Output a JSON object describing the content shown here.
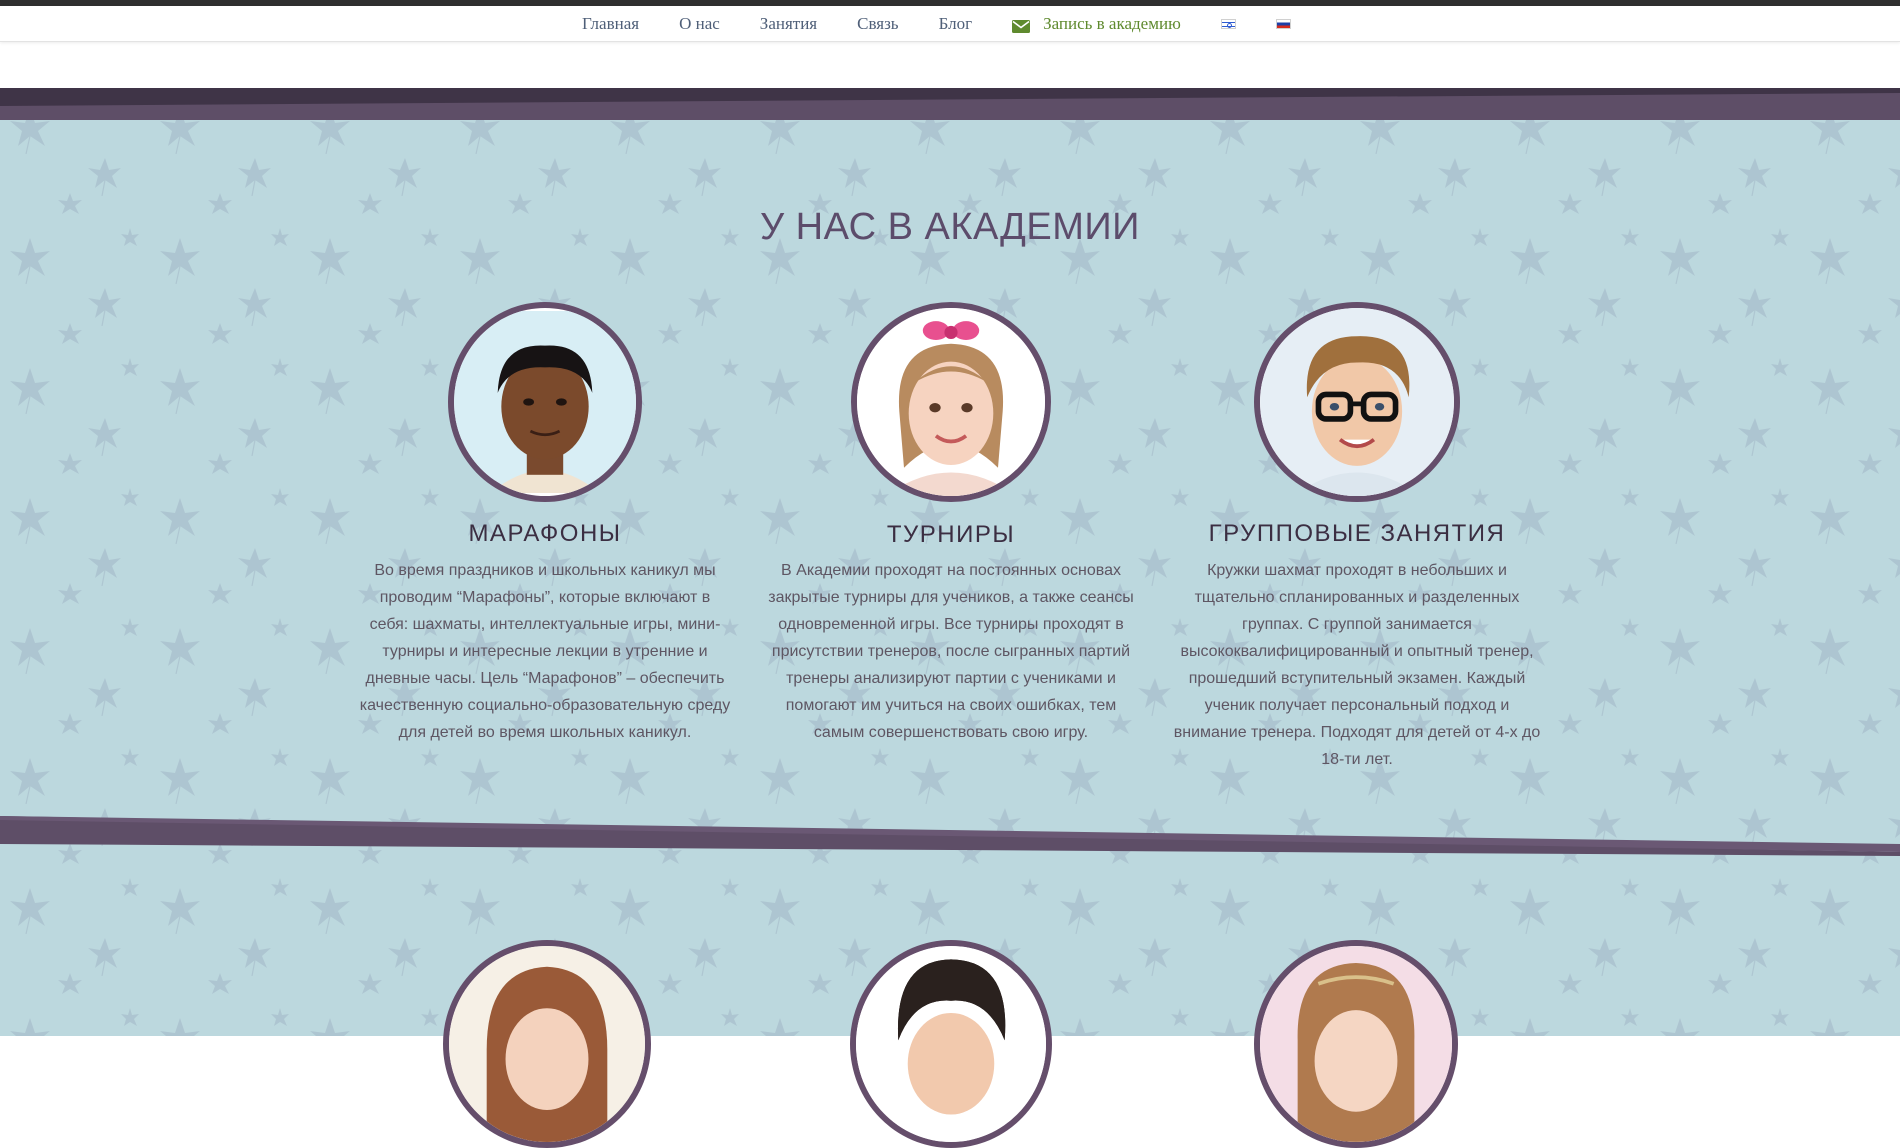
{
  "nav": {
    "items": [
      {
        "label": "Главная"
      },
      {
        "label": "О нас"
      },
      {
        "label": "Занятия"
      },
      {
        "label": "Связь"
      },
      {
        "label": "Блог"
      }
    ],
    "cta_label": "Запись в академию",
    "cta_icon": "envelope-icon",
    "languages": [
      "he",
      "ru"
    ]
  },
  "section": {
    "title": "У НАС В АКАДЕМИИ"
  },
  "cards": [
    {
      "title": "МАРАФОНЫ",
      "text": "Во время праздников и школьных каникул мы проводим “Марафоны”, которые включают в себя: шахматы, интеллектуальные игры, мини-турниры и интересные лекции в утренние и дневные часы. Цель “Марафонов” – обеспечить качественную социально-образовательную среду для детей во время школьных каникул."
    },
    {
      "title": "ТУРНИРЫ",
      "text": "В Академии проходят на постоянных основах закрытые турниры для учеников, а также сеансы одновременной игры. Все турниры проходят в присутствии тренеров, после сыгранных партий тренеры анализируют партии с учениками и помогают им учиться на своих ошибках, тем самым совершенствовать свою игру."
    },
    {
      "title": "ГРУППОВЫЕ ЗАНЯТИЯ",
      "text": "Кружки шахмат проходят в небольших и тщательно спланированных и разделенных группах. С группой занимается высококвалифицированный и опытный тренер, прошедший вступительный экзамен. Каждый ученик получает персональный подход и внимание тренера. Подходят для детей от 4-х до 18-ти лет."
    }
  ],
  "colors": {
    "band": "#bcd8de",
    "accent": "#654e6b",
    "title": "#5c4c6b",
    "nav_link": "#4f5f78",
    "cta": "#5f8a2e"
  }
}
